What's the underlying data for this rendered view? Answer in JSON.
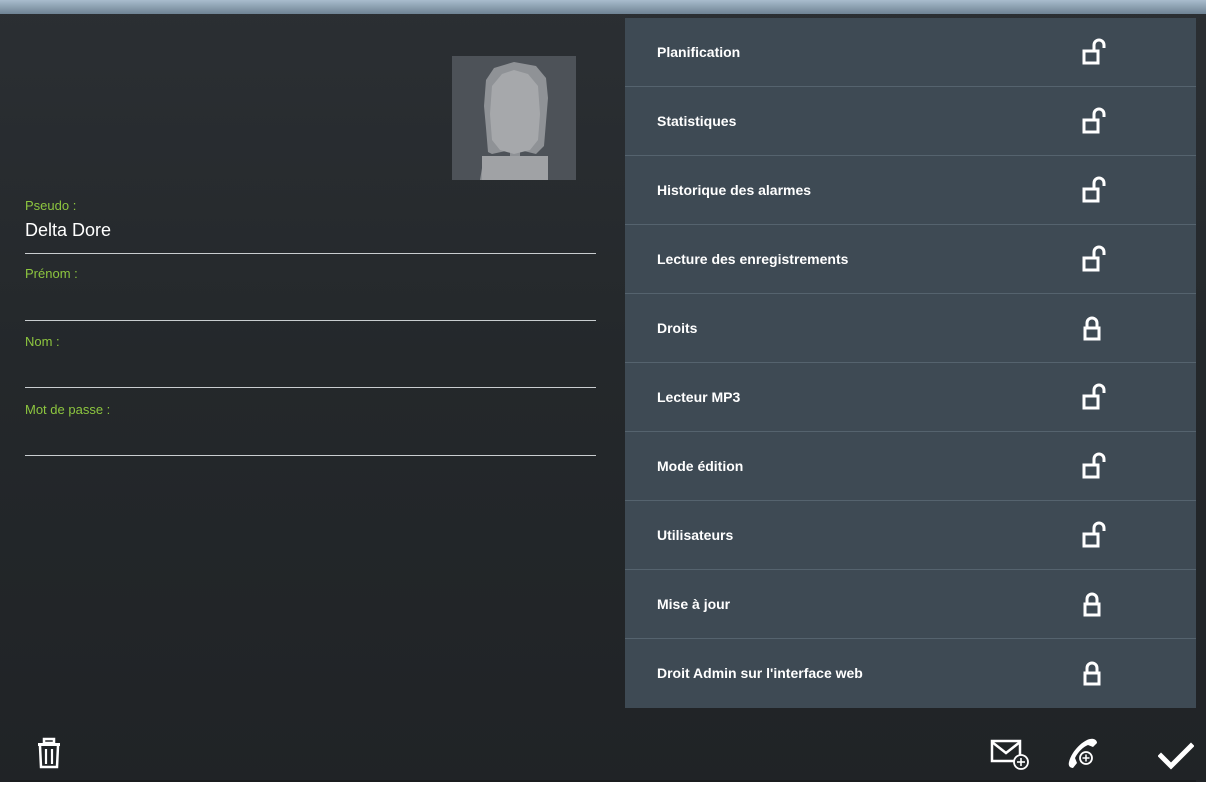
{
  "form": {
    "pseudo_label": "Pseudo :",
    "pseudo_value": "Delta Dore",
    "prenom_label": "Prénom :",
    "prenom_value": "",
    "nom_label": "Nom :",
    "nom_value": "",
    "password_label": "Mot de passe :",
    "password_value": ""
  },
  "rights": [
    {
      "label": "Planification",
      "icon": "lock-open-icon"
    },
    {
      "label": "Statistiques",
      "icon": "lock-open-icon"
    },
    {
      "label": "Historique des alarmes",
      "icon": "lock-open-icon"
    },
    {
      "label": "Lecture des enregistrements",
      "icon": "lock-open-icon"
    },
    {
      "label": "Droits",
      "icon": "lock-closed-icon"
    },
    {
      "label": "Lecteur MP3",
      "icon": "lock-open-icon"
    },
    {
      "label": "Mode édition",
      "icon": "lock-open-icon"
    },
    {
      "label": "Utilisateurs",
      "icon": "lock-open-icon"
    },
    {
      "label": "Mise à jour",
      "icon": "lock-closed-icon"
    },
    {
      "label": "Droit Admin sur l'interface web",
      "icon": "lock-closed-icon"
    }
  ],
  "toolbar": {
    "delete_icon": "trash-icon",
    "add_email_icon": "mail-add-icon",
    "add_phone_icon": "phone-add-icon",
    "confirm_icon": "check-icon"
  },
  "colors": {
    "label_accent": "#8dc63f",
    "panel_bg": "#3e4a54",
    "text": "#ffffff"
  }
}
